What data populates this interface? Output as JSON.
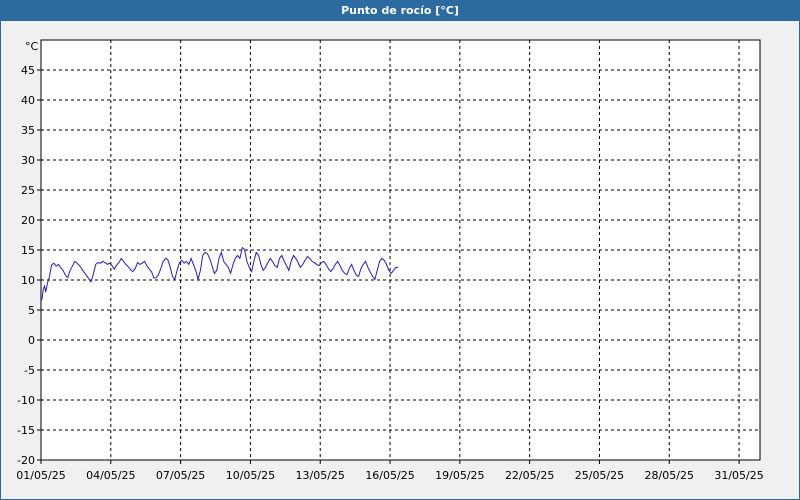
{
  "window": {
    "title": "Punto de rocío [°C]"
  },
  "colors": {
    "title_bar": "#2c6aa0",
    "line": "#1f1fbf",
    "panel": "#f0f0f0",
    "plot_bg": "#ffffff"
  },
  "chart_data": {
    "type": "line",
    "title": "Punto de rocío [°C]",
    "ylabel": "°C",
    "xlabel": "",
    "grid": true,
    "grid_style": "dashed",
    "ylim": [
      -20,
      50
    ],
    "yticks": [
      -20,
      -15,
      -10,
      -5,
      0,
      5,
      10,
      15,
      20,
      25,
      30,
      35,
      40,
      45
    ],
    "xlim": [
      0,
      30.9
    ],
    "xticks": [
      {
        "value": 0,
        "label": "01/05/25"
      },
      {
        "value": 3,
        "label": "04/05/25"
      },
      {
        "value": 6,
        "label": "07/05/25"
      },
      {
        "value": 9,
        "label": "10/05/25"
      },
      {
        "value": 12,
        "label": "13/05/25"
      },
      {
        "value": 15,
        "label": "16/05/25"
      },
      {
        "value": 18,
        "label": "19/05/25"
      },
      {
        "value": 21,
        "label": "22/05/25"
      },
      {
        "value": 24,
        "label": "25/05/25"
      },
      {
        "value": 27,
        "label": "28/05/25"
      },
      {
        "value": 30,
        "label": "31/05/25"
      }
    ],
    "series": [
      {
        "x": [
          0.0,
          0.05,
          0.1,
          0.15,
          0.2,
          0.28,
          0.36,
          0.45,
          0.55,
          0.65,
          0.75,
          0.85,
          0.95,
          1.05,
          1.15,
          1.25,
          1.35,
          1.45,
          1.55,
          1.65,
          1.75,
          1.85,
          1.95,
          2.05,
          2.15,
          2.25,
          2.35,
          2.45,
          2.55,
          2.65,
          2.75,
          2.85,
          2.95,
          3.05,
          3.15,
          3.25,
          3.35,
          3.45,
          3.55,
          3.65,
          3.75,
          3.85,
          3.95,
          4.05,
          4.15,
          4.25,
          4.35,
          4.45,
          4.55,
          4.65,
          4.75,
          4.85,
          4.95,
          5.05,
          5.15,
          5.25,
          5.35,
          5.45,
          5.55,
          5.65,
          5.75,
          5.85,
          5.95,
          6.05,
          6.15,
          6.25,
          6.35,
          6.45,
          6.55,
          6.65,
          6.75,
          6.85,
          6.95,
          7.05,
          7.15,
          7.25,
          7.35,
          7.45,
          7.55,
          7.65,
          7.75,
          7.85,
          7.95,
          8.05,
          8.15,
          8.25,
          8.35,
          8.45,
          8.55,
          8.65,
          8.75,
          8.85,
          8.95,
          9.05,
          9.15,
          9.25,
          9.35,
          9.45,
          9.55,
          9.65,
          9.75,
          9.85,
          9.95,
          10.05,
          10.15,
          10.25,
          10.35,
          10.45,
          10.55,
          10.65,
          10.75,
          10.85,
          10.95,
          11.05,
          11.15,
          11.25,
          11.35,
          11.45,
          11.55,
          11.65,
          11.75,
          11.85,
          11.95,
          12.05,
          12.15,
          12.25,
          12.35,
          12.45,
          12.55,
          12.65,
          12.75,
          12.85,
          12.95,
          13.05,
          13.15,
          13.25,
          13.35,
          13.45,
          13.55,
          13.65,
          13.75,
          13.85,
          13.95,
          14.05,
          14.15,
          14.25,
          14.35,
          14.45,
          14.55,
          14.65,
          14.75,
          14.85,
          14.95,
          15.05,
          15.15,
          15.25,
          15.35
        ],
        "values": [
          6.5,
          7.0,
          8.5,
          9.0,
          8.0,
          9.5,
          10.5,
          12.5,
          12.8,
          12.3,
          12.6,
          12.0,
          11.6,
          10.8,
          10.4,
          11.6,
          12.3,
          13.1,
          12.8,
          12.4,
          11.9,
          11.3,
          10.8,
          10.2,
          9.7,
          11.0,
          12.6,
          12.9,
          12.8,
          13.1,
          12.9,
          12.6,
          12.8,
          12.4,
          11.8,
          12.5,
          12.9,
          13.6,
          13.1,
          12.6,
          12.2,
          11.7,
          11.4,
          11.9,
          12.9,
          12.6,
          12.8,
          13.1,
          12.4,
          11.8,
          11.4,
          10.3,
          10.4,
          10.9,
          11.9,
          13.1,
          13.6,
          13.4,
          12.2,
          10.6,
          10.1,
          11.6,
          12.9,
          13.3,
          12.8,
          13.1,
          12.6,
          13.6,
          12.6,
          11.6,
          10.1,
          11.6,
          14.1,
          14.6,
          14.4,
          13.6,
          12.4,
          11.1,
          11.6,
          13.6,
          14.6,
          13.1,
          12.6,
          12.1,
          11.1,
          12.6,
          13.6,
          14.1,
          13.6,
          15.4,
          15.1,
          13.1,
          12.1,
          11.4,
          13.1,
          14.6,
          14.1,
          12.6,
          11.6,
          12.1,
          12.9,
          13.6,
          13.1,
          12.4,
          12.1,
          13.6,
          14.1,
          13.1,
          12.4,
          11.6,
          13.1,
          14.1,
          13.6,
          12.9,
          12.1,
          12.6,
          13.3,
          13.9,
          13.6,
          13.1,
          12.9,
          12.6,
          12.4,
          12.9,
          13.1,
          12.6,
          11.9,
          11.4,
          11.9,
          12.6,
          13.1,
          12.4,
          11.6,
          11.1,
          10.9,
          11.9,
          12.6,
          11.6,
          10.8,
          10.6,
          11.9,
          12.6,
          13.1,
          12.1,
          11.3,
          10.6,
          10.1,
          11.6,
          13.1,
          13.6,
          13.3,
          12.6,
          11.6,
          11.1,
          11.6,
          12.1,
          12.1
        ]
      }
    ]
  }
}
